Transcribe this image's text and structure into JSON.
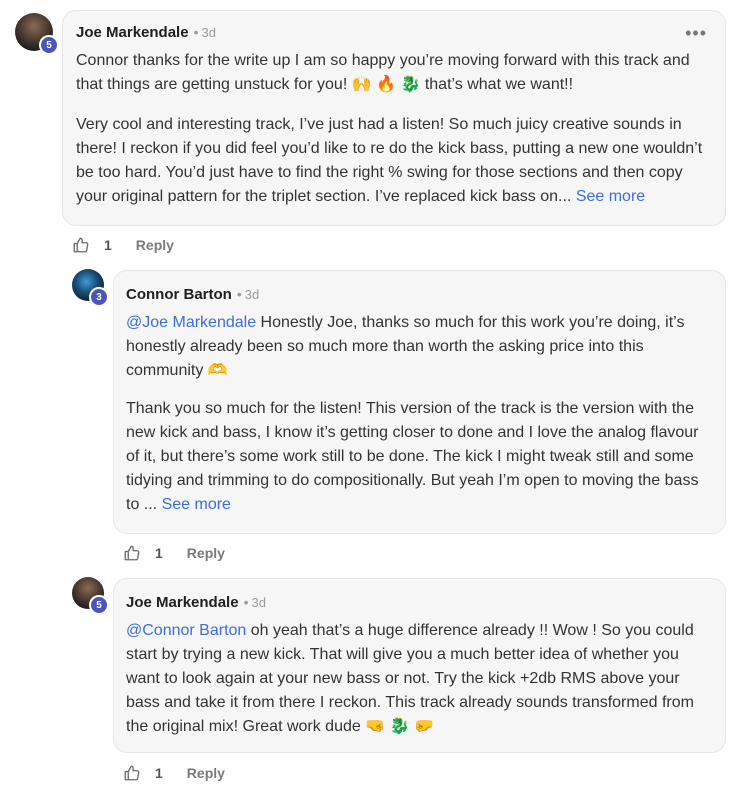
{
  "comments": [
    {
      "author": "Joe Markendale",
      "level": "5",
      "time": "3d",
      "menu": "•••",
      "p1_text": "Connor thanks for the write up I am so happy you’re moving forward with this track and that things are getting unstuck for you! 🙌 🔥 🐉  that’s what we want!!",
      "p2_text": "Very cool and interesting track, I’ve just had a listen! So much juicy creative sounds in there! I reckon if you did feel you’d like to re do the kick bass, putting a new one wouldn’t be too hard. You’d just have to find the right % swing for those sections and then copy your original pattern for the triplet section. I’ve replaced kick bass on...",
      "see_more": "See more",
      "likes": "1",
      "reply": "Reply"
    },
    {
      "author": "Connor Barton",
      "level": "3",
      "time": "3d",
      "mention": "@Joe Markendale",
      "p1_text": " Honestly Joe, thanks so much for this work you’re doing, it’s honestly already been so much more than worth the asking price into this community 🫶",
      "p2_text": "Thank you so much for the listen! This version of the track is the version with the new kick and bass, I know it’s getting closer to done and I love the analog flavour of it, but there’s some work still to be done. The kick I might tweak still and some tidying and trimming to do compositionally. But yeah I’m open to moving the bass to ...",
      "see_more": "See more",
      "likes": "1",
      "reply": "Reply"
    },
    {
      "author": "Joe Markendale",
      "level": "5",
      "time": "3d",
      "mention": "@Connor Barton",
      "p1_text": " oh yeah that’s a huge difference already !! Wow ! So you could start by trying a new kick. That will give you a much better idea of whether you want to look again at your new bass or not. Try the kick +2db RMS above your bass and take it from there I reckon. This track already sounds transformed from the original mix! Great work dude 🤜 🐉 🤛",
      "likes": "1",
      "reply": "Reply"
    }
  ],
  "colors": {
    "accent": "#3b6ed6",
    "badge": "#4a55b8",
    "bubble": "#f6f6f6"
  }
}
